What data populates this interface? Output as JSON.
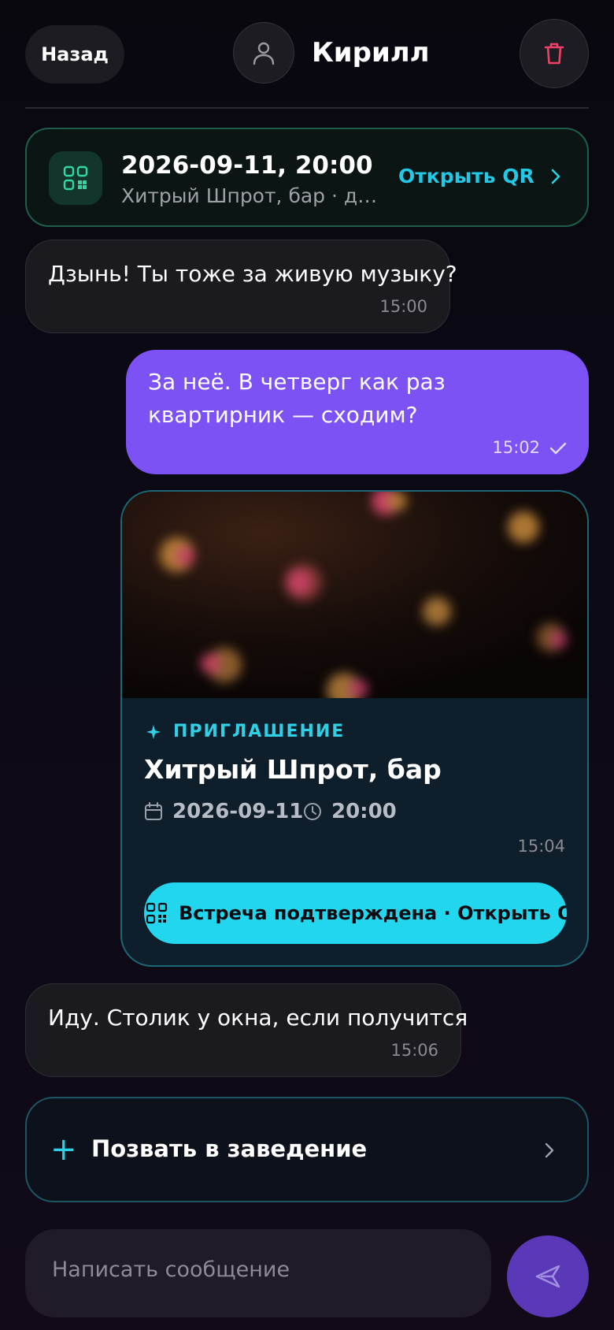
{
  "header": {
    "back_label": "Назад",
    "contact_name": "Кирилл"
  },
  "meeting_banner": {
    "title": "2026-09-11, 20:00",
    "subtitle": "Хитрый Шпрот, бар · два…",
    "action_label": "Открыть QR"
  },
  "messages": [
    {
      "direction": "in",
      "text": "Дзынь! Ты тоже за живую музыку?",
      "time": "15:00"
    },
    {
      "direction": "out",
      "text": "За неё. В четверг как раз квартирник — сходим?",
      "time": "15:02"
    },
    {
      "direction": "in",
      "text": "Иду. Столик у окна, если получится",
      "time": "15:06"
    }
  ],
  "invite_card": {
    "tag": "ПРИГЛАШЕНИЕ",
    "title": "Хитрый Шпрот, бар",
    "date": "2026-09-11",
    "time_of_event": "20:00",
    "message_time": "15:04",
    "button_label": "Встреча подтверждена · Открыть QR"
  },
  "invite_venue": {
    "label": "Позвать в заведение"
  },
  "composer": {
    "placeholder": "Написать сообщение"
  },
  "colors": {
    "accent_cyan": "#22d6ee",
    "outgoing_bubble": "#7d52f5",
    "delete_red": "#f0406a",
    "banner_green": "#22c58e"
  }
}
